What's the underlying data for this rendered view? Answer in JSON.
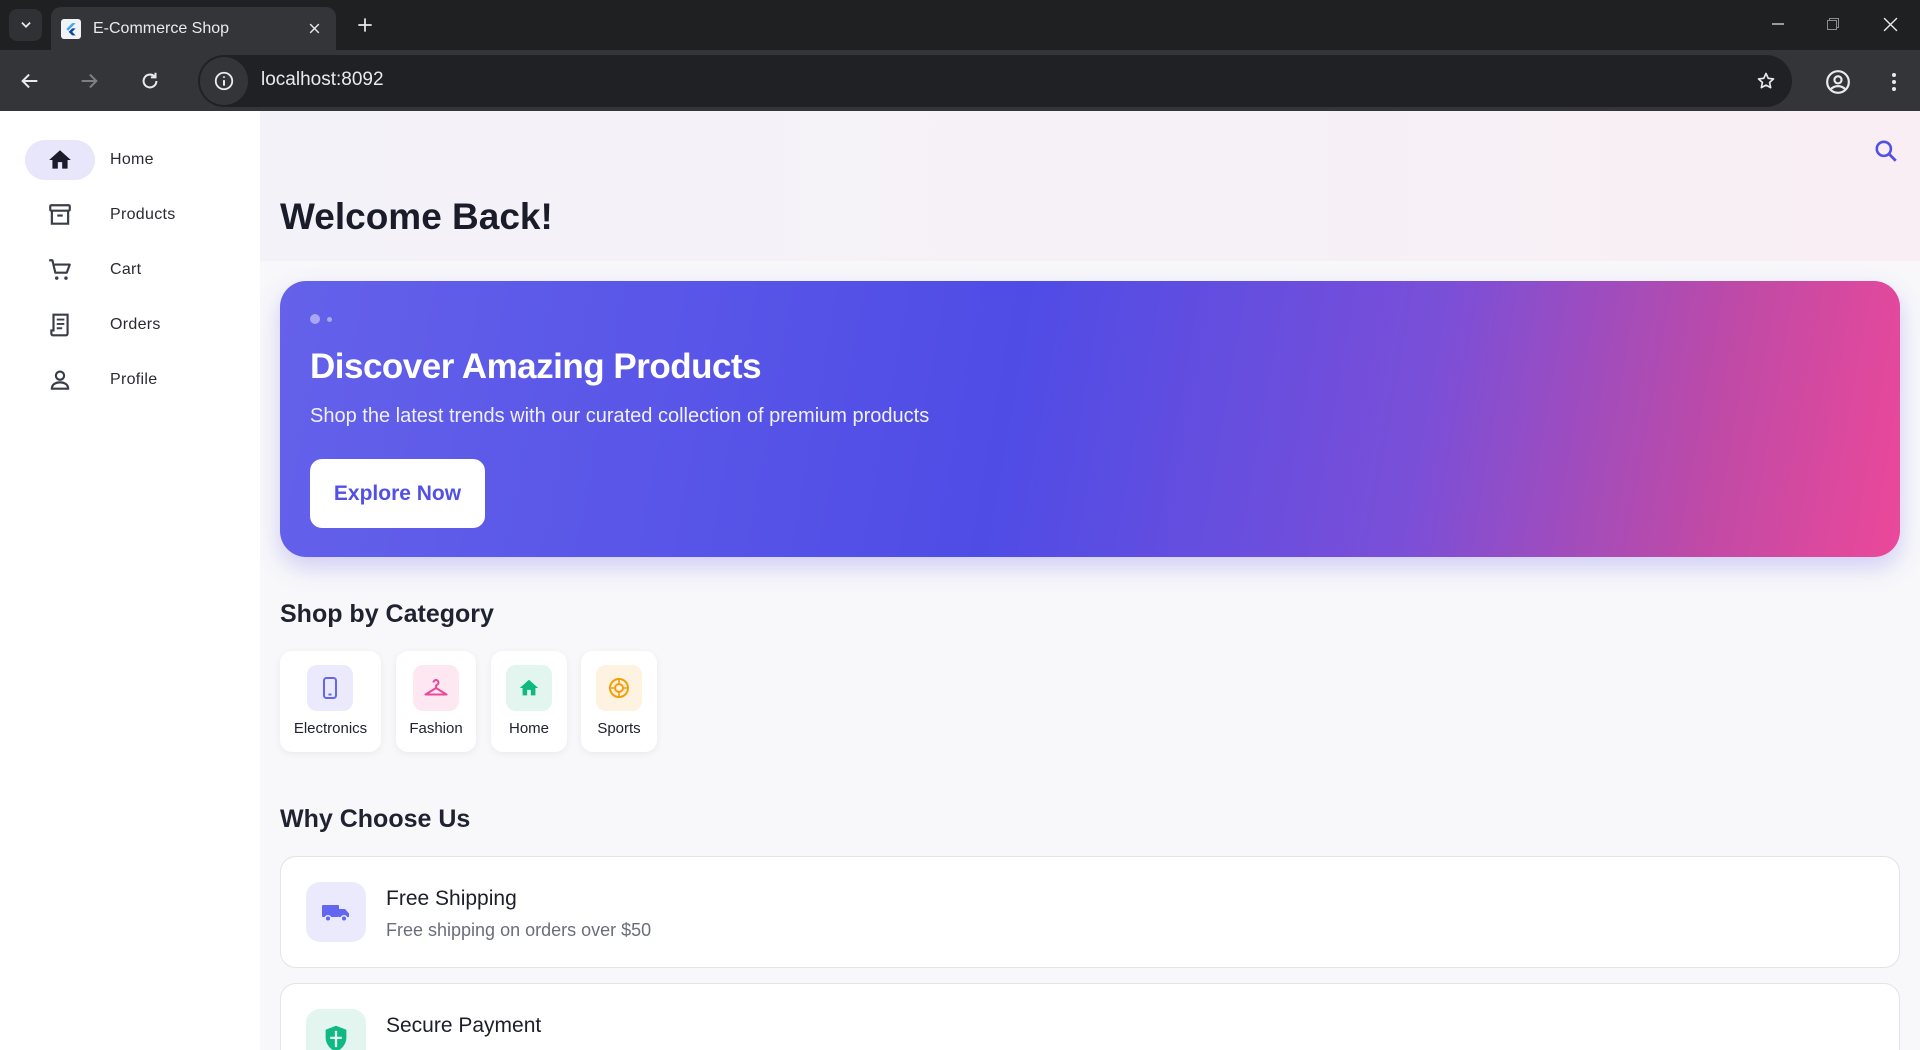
{
  "browser": {
    "tab_title": "E-Commerce Shop",
    "url": "localhost:8092"
  },
  "sidebar": {
    "items": [
      {
        "label": "Home",
        "icon": "home-icon",
        "active": true
      },
      {
        "label": "Products",
        "icon": "archive-box-icon",
        "active": false
      },
      {
        "label": "Cart",
        "icon": "cart-icon",
        "active": false
      },
      {
        "label": "Orders",
        "icon": "receipt-icon",
        "active": false
      },
      {
        "label": "Profile",
        "icon": "person-icon",
        "active": false
      }
    ]
  },
  "header": {
    "title": "Welcome Back!"
  },
  "hero": {
    "title": "Discover Amazing Products",
    "subtitle": "Shop the latest trends with our curated collection of premium products",
    "button_label": "Explore Now",
    "carousel_pages": 2,
    "carousel_active": 1
  },
  "categories": {
    "title": "Shop by Category",
    "items": [
      {
        "label": "Electronics",
        "icon": "smartphone-icon",
        "color": "#6366f1"
      },
      {
        "label": "Fashion",
        "icon": "hanger-icon",
        "color": "#ec4899"
      },
      {
        "label": "Home",
        "icon": "home-icon",
        "color": "#10b981"
      },
      {
        "label": "Sports",
        "icon": "ball-icon",
        "color": "#f59e0b"
      }
    ]
  },
  "features": {
    "title": "Why Choose Us",
    "items": [
      {
        "title": "Free Shipping",
        "description": "Free shipping on orders over $50",
        "icon": "truck-icon",
        "color": "#6366f1"
      },
      {
        "title": "Secure Payment",
        "description": "",
        "icon": "shield-icon",
        "color": "#10b981"
      }
    ]
  },
  "colors": {
    "primary": "#5350e6",
    "accent": "#ec4899"
  }
}
